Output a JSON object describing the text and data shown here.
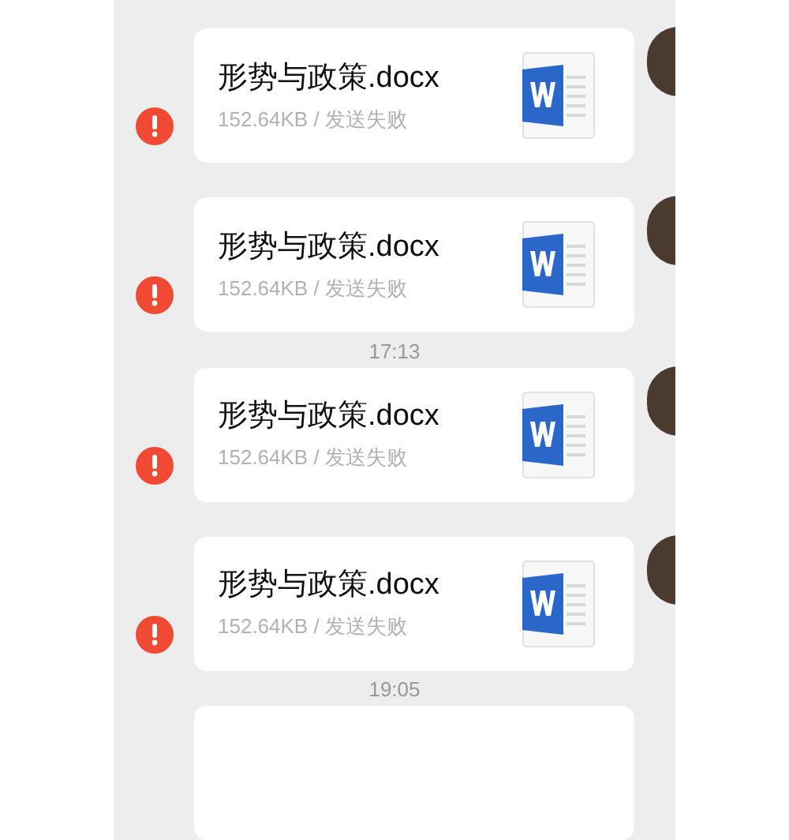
{
  "messages": [
    {
      "kind": "file",
      "filename": "形势与政策.docx",
      "meta": "152.64KB / 发送失败",
      "failed": true
    },
    {
      "kind": "file",
      "filename": "形势与政策.docx",
      "meta": "152.64KB / 发送失败",
      "failed": true
    },
    {
      "kind": "time",
      "text": "17:13"
    },
    {
      "kind": "file",
      "filename": "形势与政策.docx",
      "meta": "152.64KB / 发送失败",
      "failed": true
    },
    {
      "kind": "file",
      "filename": "形势与政策.docx",
      "meta": "152.64KB / 发送失败",
      "failed": true
    },
    {
      "kind": "time",
      "text": "19:05"
    },
    {
      "kind": "cut"
    }
  ]
}
